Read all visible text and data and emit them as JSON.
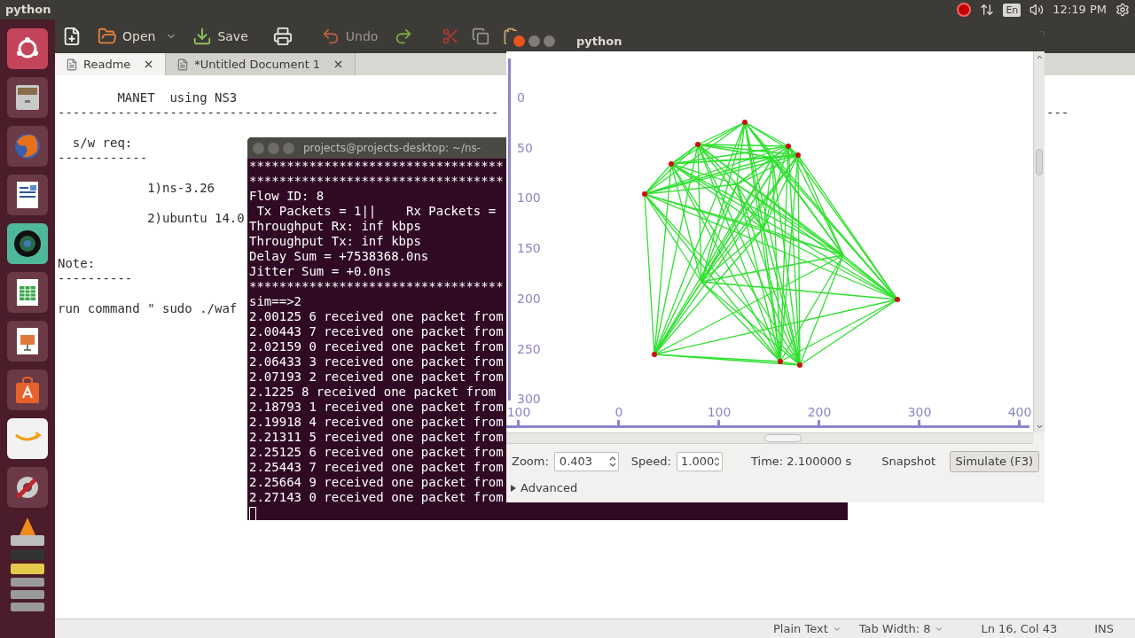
{
  "top_panel": {
    "title": "python",
    "keyboard": "En",
    "clock": "12:19 PM"
  },
  "editor": {
    "toolbar": {
      "open": "Open",
      "save": "Save",
      "undo": "Undo"
    },
    "tabs": [
      {
        "label": "Readme",
        "selected": true
      },
      {
        "label": "*Untitled Document 1",
        "selected": false
      }
    ],
    "lines": [
      {
        "kind": "blank"
      },
      {
        "kind": "text",
        "text": "        MANET  using NS3"
      },
      {
        "kind": "text",
        "text": "-----------------------------------------------------------"
      },
      {
        "kind": "blank"
      },
      {
        "kind": "text",
        "text": "  s/w req:"
      },
      {
        "kind": "text",
        "text": "------------"
      },
      {
        "kind": "blank"
      },
      {
        "kind": "text",
        "text": "            1)ns-3.26"
      },
      {
        "kind": "blank"
      },
      {
        "kind": "text",
        "text": "            2)ubuntu 14.0"
      },
      {
        "kind": "blank"
      },
      {
        "kind": "blank"
      },
      {
        "kind": "text",
        "text": "Note:"
      },
      {
        "kind": "text",
        "text": "----------"
      },
      {
        "kind": "blank"
      },
      {
        "kind": "text",
        "text": "run command \" sudo ./waf"
      }
    ],
    "dash_fragment": "---",
    "status_bar": {
      "language": "Plain Text",
      "tab_width": "Tab Width: 8",
      "position": "Ln 16, Col 43",
      "mode": "INS"
    }
  },
  "terminal": {
    "title": "projects@projects-desktop: ~/ns-",
    "lines": [
      "**********************************",
      "**********************************",
      "Flow ID: 8",
      " Tx Packets = 1||    Rx Packets =",
      "Throughput Rx: inf kbps",
      "Throughput Tx: inf kbps",
      "Delay Sum = +7538368.0ns",
      "Jitter Sum = +0.0ns",
      "**********************************",
      "sim==>2",
      "2.00125 6 received one packet from",
      "2.00443 7 received one packet from",
      "2.02159 0 received one packet from",
      "2.06433 3 received one packet from",
      "2.07193 2 received one packet from",
      "2.1225 8 received one packet from",
      "2.18793 1 received one packet from",
      "2.19918 4 received one packet from",
      "2.21311 5 received one packet from",
      "2.25125 6 received one packet from",
      "2.25443 7 received one packet from",
      "2.25664 9 received one packet from",
      "2.27143 0 received one packet from"
    ]
  },
  "viewer": {
    "title": "python",
    "y_ruler": [
      "0",
      "50",
      "100",
      "150",
      "200",
      "250",
      "300"
    ],
    "x_ruler": [
      "100",
      "0",
      "100",
      "200",
      "300",
      "400"
    ],
    "zoom": {
      "label": "Zoom:",
      "value": "0.403"
    },
    "speed": {
      "label": "Speed:",
      "value": "1.000"
    },
    "time": "Time: 2.100000 s",
    "snapshot": "Snapshot",
    "simulate": "Simulate (F3)",
    "advanced": {
      "label": "Advanced",
      "expanded": false
    }
  }
}
